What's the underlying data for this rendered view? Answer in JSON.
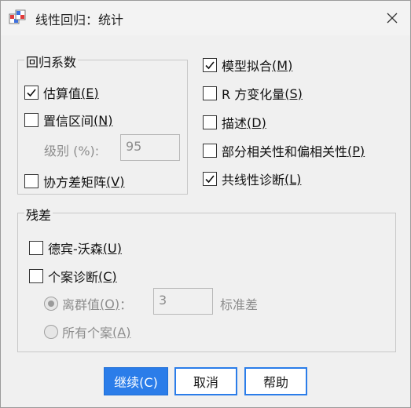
{
  "window": {
    "title": "线性回归：统计"
  },
  "regression_coefficients": {
    "label": "回归系数",
    "estimates": {
      "text": "估算值",
      "key": "(E)",
      "checked": true
    },
    "confidence_intervals": {
      "text": "置信区间",
      "key": "(N)",
      "checked": false
    },
    "level": {
      "label": "级别 (%):",
      "value": "95"
    },
    "covariance_matrix": {
      "text": "协方差矩阵",
      "key": "(V)",
      "checked": false
    }
  },
  "right_options": {
    "model_fit": {
      "text": "模型拟合",
      "key": "(M)",
      "checked": true
    },
    "r_squared_change": {
      "text": "R 方变化量",
      "key": "(S)",
      "checked": false
    },
    "descriptives": {
      "text": "描述",
      "key": "(D)",
      "checked": false
    },
    "part_partial": {
      "text": "部分相关性和偏相关性",
      "key": "(P)",
      "checked": false
    },
    "collinearity": {
      "text": "共线性诊断",
      "key": "(L)",
      "checked": true
    }
  },
  "residuals": {
    "label": "残差",
    "durbin_watson": {
      "text": "德宾-沃森",
      "key": "(U)",
      "checked": false
    },
    "casewise": {
      "text": "个案诊断",
      "key": "(C)",
      "checked": false
    },
    "outliers": {
      "text": "离群值",
      "key": "(O)",
      "suffix": "：",
      "value": "3",
      "unit": "标准差",
      "selected": true
    },
    "all_cases": {
      "text": "所有个案",
      "key": "(A)",
      "selected": false
    }
  },
  "buttons": {
    "continue": "继续(C)",
    "cancel": "取消",
    "help": "帮助"
  },
  "colors": {
    "accent": "#2b7de9",
    "disabled_text": "#8d8d8d"
  }
}
